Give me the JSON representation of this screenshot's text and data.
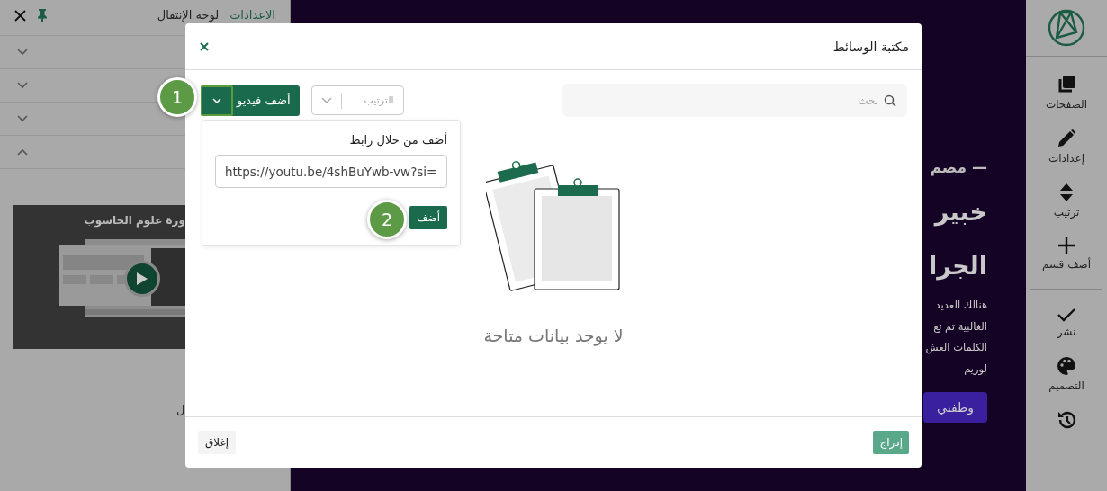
{
  "nav_panel": {
    "tabs": [
      {
        "label": "الاعدادات",
        "selected": true
      },
      {
        "label": "لوحة الإنتقال",
        "selected": false
      }
    ],
    "sections": [
      {
        "expanded": false
      },
      {
        "expanded": false
      },
      {
        "expanded": false
      },
      {
        "expanded": true
      }
    ],
    "video_card": {
      "title": "ورة علوم الحاسوب"
    },
    "caption": "ل"
  },
  "canvas": {
    "eyebrow": "— مصم",
    "heading_lines": [
      "خبير",
      "الجرا"
    ],
    "paragraph_lines": [
      "هنالك العديد",
      "الغالبية تم تع",
      "الكلمات العش",
      "لوريم"
    ],
    "button": "وظفني"
  },
  "sidebar": {
    "items": [
      {
        "kind": "pages",
        "label": "الصفحات"
      },
      {
        "kind": "edit",
        "label": "إعدادات"
      },
      {
        "kind": "sort",
        "label": "ترتيب"
      },
      {
        "kind": "add",
        "label": "أضف قسم"
      },
      {
        "kind": "publish",
        "label": "نشر"
      },
      {
        "kind": "design",
        "label": "التصميم"
      },
      {
        "kind": "history"
      }
    ]
  },
  "modal": {
    "title": "مكتبة الوسائط",
    "search": {
      "placeholder": "بحث"
    },
    "sort": {
      "placeholder": "الترتيب"
    },
    "add_button": "أضف فيديو",
    "popover": {
      "label": "أضف من خلال رابط",
      "url": "https://youtu.be/4shBuYwb-vw?si=",
      "add_button": "أضف"
    },
    "empty_text": "لا يوجد بيانات متاحة",
    "insert_button": "إدراج",
    "close_button": "إغلاق"
  },
  "annotations": [
    "1",
    "2"
  ]
}
